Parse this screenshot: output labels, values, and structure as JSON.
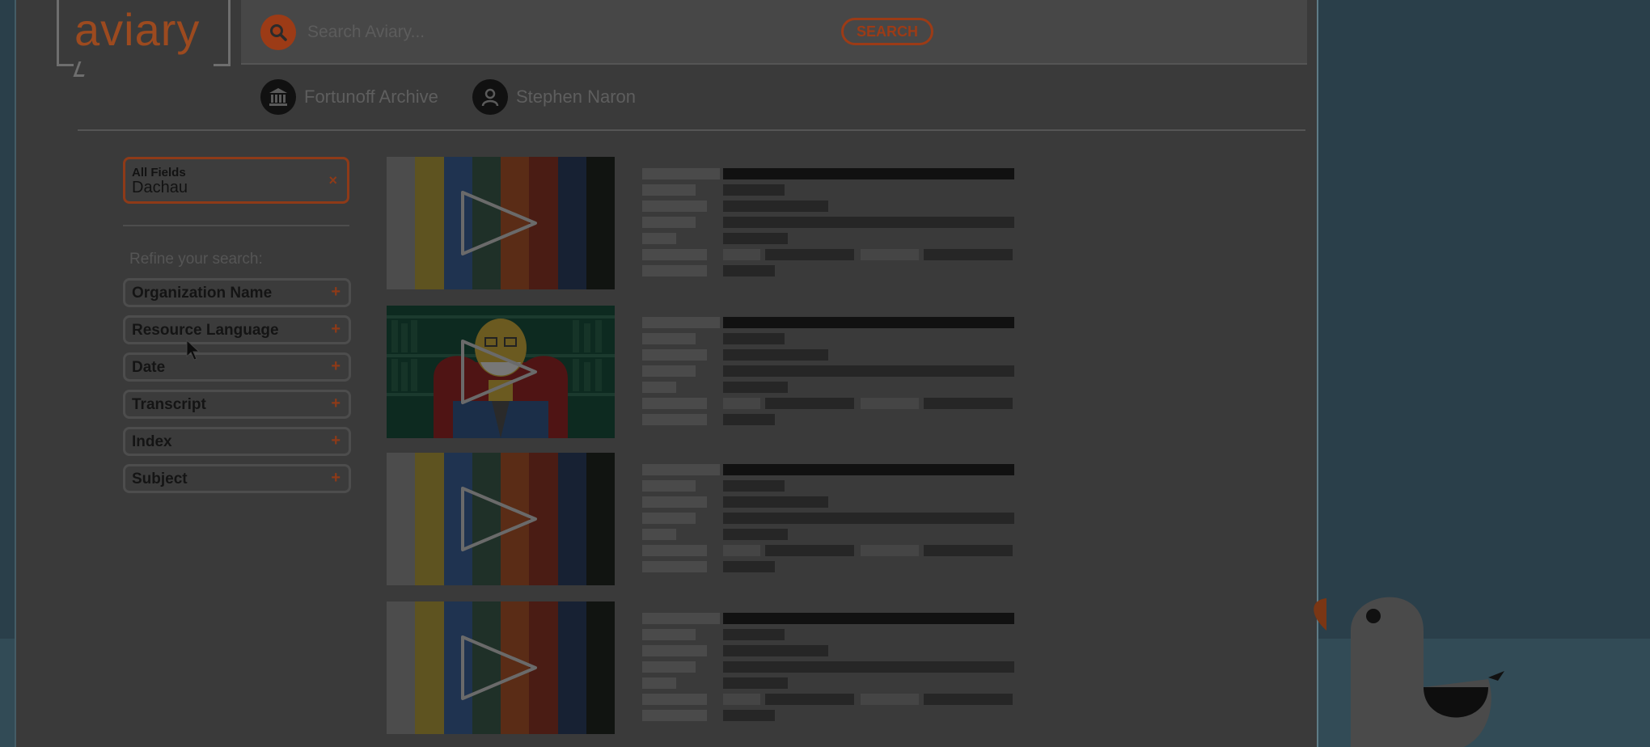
{
  "header": {
    "logo_text": "aviary",
    "search": {
      "placeholder": "Search Aviary...",
      "button_label": "SEARCH"
    }
  },
  "breadcrumb": {
    "organization": "Fortunoff Archive",
    "user": "Stephen Naron"
  },
  "filters": {
    "active_chip": {
      "field": "All Fields",
      "value": "Dachau",
      "remove_glyph": "×"
    },
    "refine_heading": "Refine your search:",
    "facets": [
      {
        "label": "Organization Name",
        "expand_glyph": "+"
      },
      {
        "label": "Resource Language",
        "expand_glyph": "+"
      },
      {
        "label": "Date",
        "expand_glyph": "+"
      },
      {
        "label": "Transcript",
        "expand_glyph": "+"
      },
      {
        "label": "Index",
        "expand_glyph": "+"
      },
      {
        "label": "Subject",
        "expand_glyph": "+"
      }
    ]
  },
  "results": [
    {
      "thumbnail": "color-bars-placeholder",
      "icon": "play-icon"
    },
    {
      "thumbnail": "interview-illustration",
      "icon": "play-icon"
    },
    {
      "thumbnail": "color-bars-placeholder",
      "icon": "play-icon"
    },
    {
      "thumbnail": "color-bars-placeholder",
      "icon": "play-icon"
    }
  ],
  "colors": {
    "accent": "#9c3b16",
    "overlay_dim": "#3a3a3a",
    "backdrop": "#2a3f4a"
  },
  "icons": {
    "search": "search-icon",
    "organization": "institution-icon",
    "user": "user-icon",
    "cursor": "mouse-pointer-icon"
  }
}
